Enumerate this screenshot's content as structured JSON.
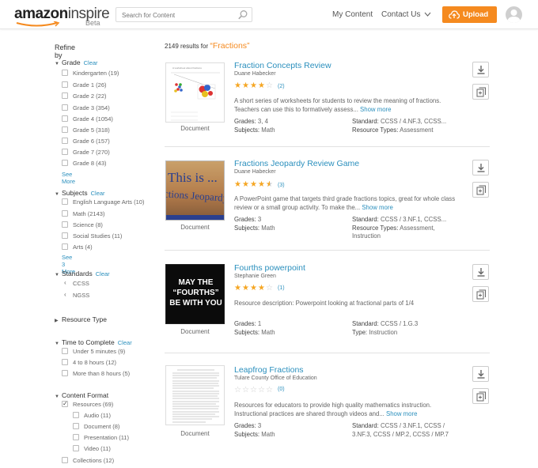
{
  "header": {
    "logo_amazon": "amazon",
    "logo_inspire": "inspire",
    "logo_beta": "Beta",
    "search_placeholder": "Search for Content",
    "my_content": "My Content",
    "contact_us": "Contact Us",
    "upload": "Upload",
    "accent_color": "#f58a1f"
  },
  "sidebar": {
    "refine_by": "Refine by",
    "clear": "Clear",
    "grade": {
      "title": "Grade",
      "options": [
        "Kindergarten (19)",
        "Grade 1 (26)",
        "Grade 2 (22)",
        "Grade 3 (354)",
        "Grade 4 (1054)",
        "Grade 5 (318)",
        "Grade 6 (157)",
        "Grade 7 (270)",
        "Grade 8 (43)"
      ],
      "see_more": "See More"
    },
    "subjects": {
      "title": "Subjects",
      "options": [
        "English Language Arts (10)",
        "Math (2143)",
        "Science (8)",
        "Social Studies (11)",
        "Arts (4)"
      ],
      "see_more": "See 3 More"
    },
    "standards": {
      "title": "Standards",
      "options": [
        "CCSS",
        "NGSS"
      ]
    },
    "resource_type": {
      "title": "Resource Type"
    },
    "time": {
      "title": "Time to Complete",
      "options": [
        "Under 5 minutes (9)",
        "4 to 8 hours (12)",
        "More than 8 hours (5)"
      ]
    },
    "format": {
      "title": "Content Format",
      "resources": "Resources (69)",
      "sub_options": [
        "Audio (11)",
        "Document (8)",
        "Presentation (11)",
        "Video (11)"
      ],
      "collections": "Collections (12)"
    }
  },
  "results": {
    "count_text": "2149 results for",
    "query": "“Fractions”",
    "doc_label": "Document",
    "grades_label": "Grades:",
    "subjects_label": "Subjects:",
    "standard_label": "Standard:",
    "resource_types_label": "Resource Types:",
    "type_label": "Type:",
    "show_more": "Show more",
    "items": [
      {
        "title": "Fraction Concepts Review",
        "author": "Duane Habecker",
        "rating": 4,
        "rating_count": "(2)",
        "desc": "A short series of worksheets for students to review the meaning of fractions. Teachers can use this to formatively assess...",
        "grades": "3, 4",
        "subjects": "Math",
        "standard": "CCSS / 4.NF.3, CCSS...",
        "resource_types": "Assessment",
        "thumb_title": "A worksheet about fractions"
      },
      {
        "title": "Fractions Jeopardy Review Game",
        "author": "Duane Habecker",
        "rating": 4.5,
        "rating_count": "(3)",
        "desc": "A PowerPoint game that targets third grade fractions topics, great for whole class review or a small group activity. To make the...",
        "grades": "3",
        "subjects": "Math",
        "standard": "CCSS / 3.NF.1, CCSS...",
        "resource_types": "Assessment, Instruction",
        "thumb_line1": "This is ...",
        "thumb_line2": "ctions Jeopardy"
      },
      {
        "title": "Fourths powerpoint",
        "author": "Stephanie Green",
        "rating": 4,
        "rating_count": "(1)",
        "desc": "Resource description: Powerpoint looking at fractional parts of 1/4",
        "grades": "1",
        "subjects": "Math",
        "standard": "CCSS / 1.G.3",
        "type": "Instruction",
        "thumb_line1": "MAY THE",
        "thumb_line2": "“FOURTHS”",
        "thumb_line3": "BE WITH YOU"
      },
      {
        "title": "Leapfrog Fractions",
        "author": "Tulare County Office of Education",
        "rating": 0,
        "rating_count": "(0)",
        "desc": "Resources for educators to provide high quality mathematics instruction. Instructional practices are shared through videos and...",
        "grades": "3",
        "subjects": "Math",
        "standard_line1": "CCSS / 3.NF.1, CCSS /",
        "standard_line2": "3.NF.3, CCSS / MP.2, CCSS / MP.7"
      }
    ]
  }
}
